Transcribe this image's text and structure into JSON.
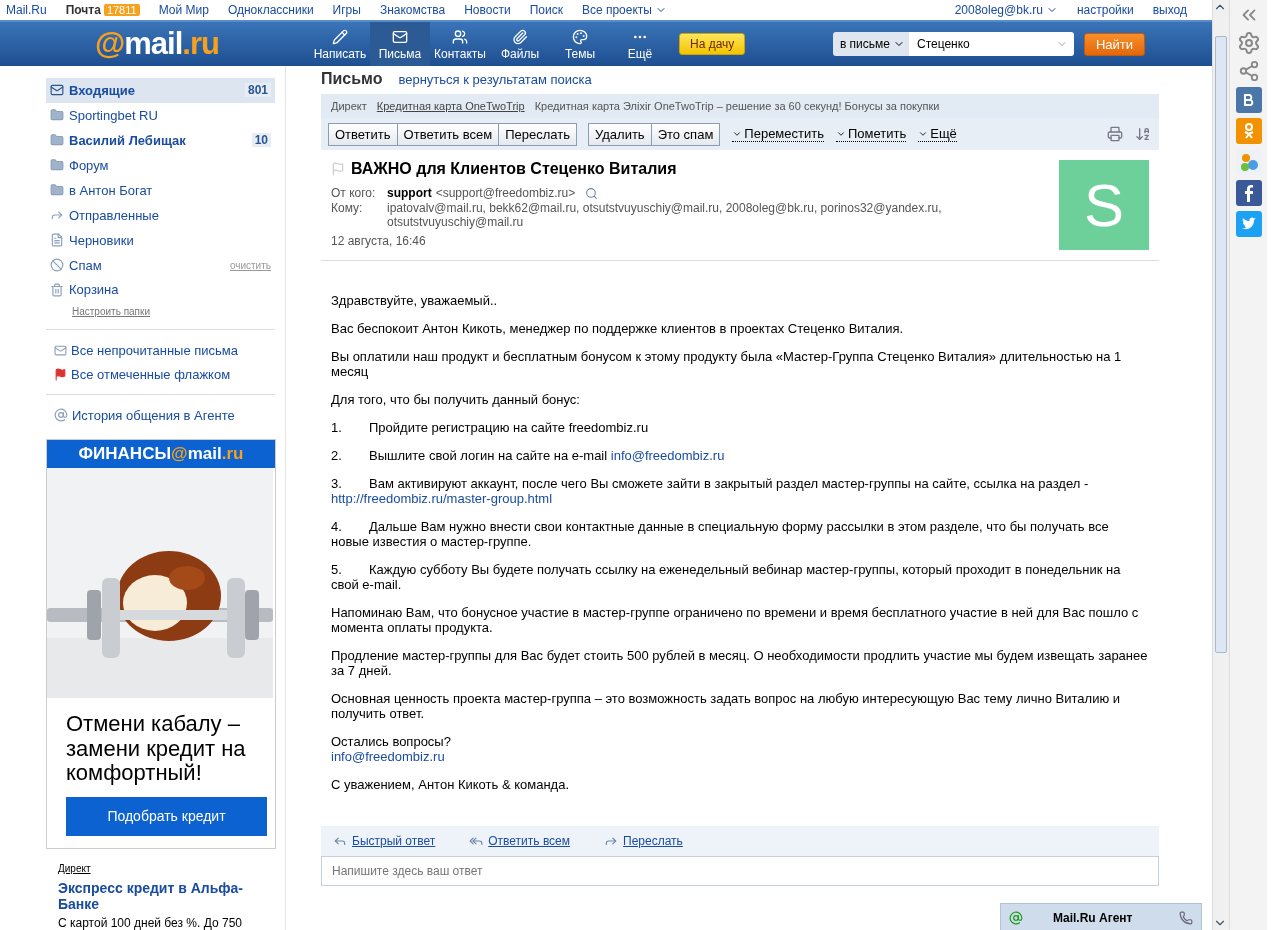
{
  "top_links": [
    {
      "label": "Mail.Ru",
      "bold": false
    },
    {
      "label": "Почта",
      "bold": true,
      "badge": "17811"
    },
    {
      "label": "Мой Мир",
      "bold": false
    },
    {
      "label": "Одноклассники",
      "bold": false
    },
    {
      "label": "Игры",
      "bold": false
    },
    {
      "label": "Знакомства",
      "bold": false
    },
    {
      "label": "Новости",
      "bold": false
    },
    {
      "label": "Поиск",
      "bold": false
    },
    {
      "label": "Все проекты",
      "bold": false,
      "dropdown": true
    }
  ],
  "account": {
    "email": "2008oleg@bk.ru",
    "links": [
      "настройки",
      "выход"
    ]
  },
  "logo": {
    "prefix": "@",
    "name": "mail",
    "suffix": ".ru"
  },
  "nav": [
    {
      "kind": "write",
      "label": "Написать",
      "selected": false
    },
    {
      "kind": "letters",
      "label": "Письма",
      "selected": true
    },
    {
      "kind": "contacts",
      "label": "Контакты",
      "selected": false
    },
    {
      "kind": "files",
      "label": "Файлы",
      "selected": false
    },
    {
      "kind": "themes",
      "label": "Темы",
      "selected": false
    },
    {
      "kind": "more",
      "label": "Ещё",
      "selected": false
    }
  ],
  "promo_button": "На дачу",
  "search": {
    "scope": "в письме",
    "value": "Стеценко",
    "button": "Найти"
  },
  "folders": [
    {
      "kind": "inbox",
      "name": "Входящие",
      "count": "801",
      "bold": true,
      "selected": true
    },
    {
      "kind": "folder",
      "name": "Sportingbet RU",
      "bold": false,
      "selected": false
    },
    {
      "kind": "folder",
      "name": "Василий Лебищак",
      "count": "10",
      "bold": true,
      "selected": false
    },
    {
      "kind": "folder",
      "name": "Форум",
      "bold": false,
      "selected": false
    },
    {
      "kind": "folder",
      "name": "в Антон Богат",
      "bold": false,
      "selected": false
    },
    {
      "kind": "sent",
      "name": "Отправленные",
      "bold": false,
      "selected": false
    },
    {
      "kind": "drafts",
      "name": "Черновики",
      "bold": false,
      "selected": false
    },
    {
      "kind": "spam",
      "name": "Спам",
      "action": "очистить",
      "bold": false,
      "selected": false
    },
    {
      "kind": "trash",
      "name": "Корзина",
      "bold": false,
      "selected": false
    }
  ],
  "folders_setup": "Настроить папки",
  "filters": [
    {
      "kind": "unread",
      "label": "Все непрочитанные письма"
    },
    {
      "kind": "flagged",
      "label": "Все отмеченные флажком"
    }
  ],
  "agent_history": "История общения в Агенте",
  "ad": {
    "brand": {
      "name": "ФИНАНСЫ",
      "at": "@",
      "mail": "mail",
      "suffix": ".ru"
    },
    "kind": "picture",
    "headline": "Отмени кабалу – замени кредит на комфортный!",
    "button": "Подобрать кредит"
  },
  "direct_ad": {
    "label": "Директ",
    "title": "Экспресс кредит в Альфа-Банке",
    "text": "С картой 100 дней без %. До 750"
  },
  "letter": {
    "heading": "Письмо",
    "back_link": "вернуться к результатам поиска",
    "direct": {
      "label": "Директ",
      "link": "Кредитная карта OneTwoTrip",
      "text": "Кредитная карта Элixir OneTwoTrip – решение за 60 секунд! Бонусы за покупки"
    },
    "toolbar_groups": [
      [
        "Ответить",
        "Ответить всем",
        "Переслать"
      ],
      [
        "Удалить",
        "Это спам"
      ]
    ],
    "menus": [
      "Переместить",
      "Пометить",
      "Ещё"
    ],
    "flagged": false,
    "subject": "ВАЖНО для Клиентов Стеценко Виталия",
    "from_label": "От кого:",
    "from_name": "support",
    "from_email": "<support@freedombiz.ru>",
    "to_label": "Кому:",
    "to": "ipatovalv@mail.ru, bekk62@mail.ru, otsutstvuyuschiy@mail.ru, 2008oleg@bk.ru, porinos32@yandex.ru, otsutstvuyuschiy@mail.ru",
    "date": "12 августа, 16:46",
    "avatar": {
      "letter": "S",
      "color": "#6dcf99"
    },
    "paragraphs": [
      {
        "kind": "plain",
        "text": "Здравствуйте, уважаемый.."
      },
      {
        "kind": "plain",
        "text": "Вас беспокоит Антон Кикоть, менеджер по поддержке клиентов в проектах Стеценко Виталия."
      },
      {
        "kind": "plain",
        "text": "Вы оплатили наш продукт и бесплатным бонусом к этому продукту была «Мастер-Группа Стеценко Виталия» длительностью на 1 месяц"
      },
      {
        "kind": "plain",
        "text": "Для того, что бы получить данный  бонус:"
      },
      {
        "kind": "numbered",
        "number": "1.",
        "text": "Пройдите регистрацию на сайте freedombiz.ru"
      },
      {
        "kind": "numbered",
        "number": "2.",
        "text": "Вышлите свой логин на сайте на e-mail",
        "link": "info@freedombiz.ru",
        "link_on_new_line": false
      },
      {
        "kind": "numbered",
        "number": "3.",
        "text": "Вам активируют аккаунт, после чего Вы сможете зайти в закрытый раздел мастер-группы на сайте, ссылка на раздел -",
        "link": "http://freedombiz.ru/master-group.html",
        "link_on_new_line": true
      },
      {
        "kind": "numbered",
        "number": "4.",
        "text": "Дальше Вам нужно внести свои контактные данные в специальную форму рассылки в этом разделе, что бы получать все новые известия о мастер-группе."
      },
      {
        "kind": "numbered",
        "number": "5.",
        "text": "Каждую субботу Вы будете получать ссылку на еженедельный вебинар мастер-группы, который проходит в понедельник на свой e-mail."
      },
      {
        "kind": "plain",
        "text": "Напоминаю Вам, что бонусное участие в мастер-группе ограничено по времени и время бесплатного участие в ней для Вас пошло с момента оплаты продукта."
      },
      {
        "kind": "plain",
        "text": "Продление мастер-группы для Вас будет стоить 500 рублей в месяц. О необходимости продлить участие мы будем извещать заранее за 7 дней."
      },
      {
        "kind": "plain",
        "text": "Основная ценность проекта мастер-группа – это возможность задать вопрос на любую интересующую Вас тему лично Виталию и получить ответ."
      },
      {
        "kind": "plain",
        "text": "Остались вопросы?",
        "link": "info@freedombiz.ru",
        "link_on_new_line": true
      },
      {
        "kind": "plain",
        "text": "С уважением, Антон Кикоть & команда."
      }
    ],
    "reply_actions": [
      {
        "kind": "reply",
        "label": "Быстрый ответ"
      },
      {
        "kind": "reply_all",
        "label": "Ответить всем"
      },
      {
        "kind": "forward",
        "label": "Переслать"
      }
    ],
    "reply_placeholder": "Напишите здесь ваш ответ"
  },
  "agent": {
    "title": "Mail.Ru Агент"
  },
  "social": [
    {
      "kind": "collapse"
    },
    {
      "kind": "settings"
    },
    {
      "kind": "share"
    },
    {
      "kind": "vk",
      "color": "#4a76a8"
    },
    {
      "kind": "ok",
      "color": "#f39200"
    },
    {
      "kind": "world",
      "color": "#eef2f6"
    },
    {
      "kind": "facebook",
      "color": "#3b5998"
    },
    {
      "kind": "twitter",
      "color": "#1da1f2"
    }
  ]
}
